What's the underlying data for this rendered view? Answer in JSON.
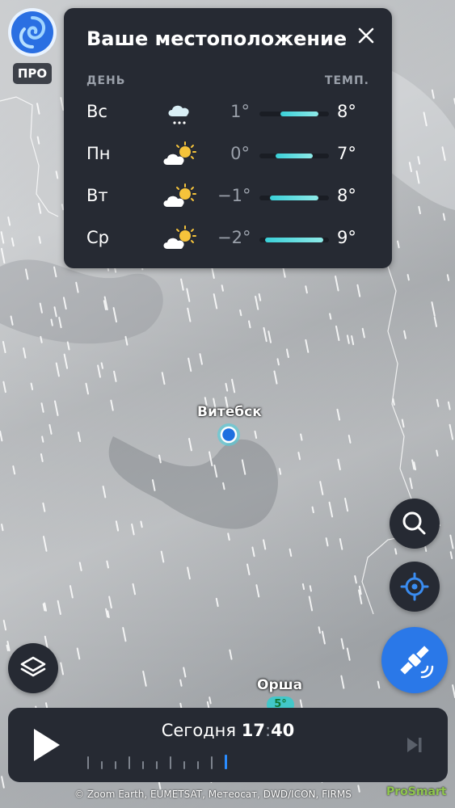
{
  "pro_badge": "ПРО",
  "forecast": {
    "title": "Ваше местоположение",
    "col_day": "ДЕНЬ",
    "col_temp": "ТЕМП.",
    "rows": [
      {
        "day": "Вс",
        "icon": "snow-cloud-icon",
        "min": "1°",
        "max": "8°",
        "range_min": 1,
        "range_max": 8
      },
      {
        "day": "Пн",
        "icon": "partly-cloudy-icon",
        "min": "0°",
        "max": "7°",
        "range_min": 0,
        "range_max": 7
      },
      {
        "day": "Вт",
        "icon": "partly-cloudy-icon",
        "min": "−1°",
        "max": "8°",
        "range_min": -1,
        "range_max": 8
      },
      {
        "day": "Ср",
        "icon": "partly-cloudy-icon",
        "min": "−2°",
        "max": "9°",
        "range_min": -2,
        "range_max": 9
      }
    ],
    "scale_min": -3,
    "scale_max": 10
  },
  "map": {
    "city_1": "Витебск",
    "city_2": "Орша",
    "city_2_temp": "5°"
  },
  "player": {
    "day_label": "Сегодня",
    "hour": "17",
    "separator": ":",
    "minute": "40",
    "current_tick": 10
  },
  "attribution": "© Zoom Earth, EUMETSAT, Метеосат, DWD/ICON, FIRMS",
  "watermark": "ProSmart",
  "colors": {
    "panel_bg": "#262a33",
    "accent_blue": "#2a78e8",
    "temp_bar": "#3ad0d8"
  }
}
